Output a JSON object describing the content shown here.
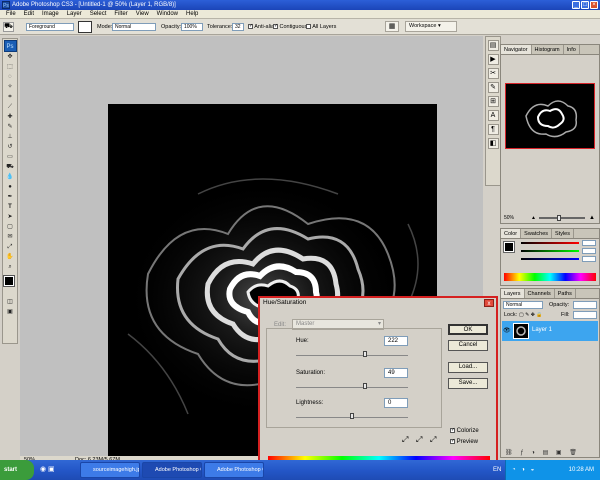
{
  "window": {
    "title": "Adobe Photoshop CS3 - [Untitled-1 @ 50% (Layer 1, RGB/8)]",
    "app_icon": "Ps"
  },
  "menu": [
    "File",
    "Edit",
    "Image",
    "Layer",
    "Select",
    "Filter",
    "View",
    "Window",
    "Help"
  ],
  "options_bar": {
    "fill_select": "Foreground",
    "mode_label": "Mode:",
    "mode_value": "Normal",
    "opacity_label": "Opacity:",
    "opacity_value": "100%",
    "tolerance_label": "Tolerance:",
    "tolerance_value": "32",
    "anti_alias_label": "Anti-alias",
    "contiguous_label": "Contiguous",
    "all_layers_label": "All Layers",
    "workspace_label": "Workspace"
  },
  "tools_panel": {
    "logo": "Ps"
  },
  "navigator_panel": {
    "tabs": [
      "Navigator",
      "Histogram",
      "Info"
    ],
    "zoom": "50%"
  },
  "color_panel": {
    "tabs": [
      "Color",
      "Swatches",
      "Styles"
    ]
  },
  "layers_panel": {
    "tabs": [
      "Layers",
      "Channels",
      "Paths"
    ],
    "blend_mode": "Normal",
    "opacity_label": "Opacity:",
    "lock_label": "Lock:",
    "fill_label": "Fill:",
    "layer_name": "Layer 1"
  },
  "status_bar": {
    "zoom": "50%",
    "doc_info": "Doc: 6.23M/5.67M"
  },
  "dialog": {
    "title": "Hue/Saturation",
    "close": "x",
    "edit_label": "Edit:",
    "edit_value": "Master",
    "hue_label": "Hue:",
    "hue_value": "222",
    "hue_fraction": 0.62,
    "saturation_label": "Saturation:",
    "saturation_value": "49",
    "saturation_fraction": 0.62,
    "lightness_label": "Lightness:",
    "lightness_value": "0",
    "lightness_fraction": 0.5,
    "ok": "OK",
    "cancel": "Cancel",
    "load": "Load...",
    "save": "Save...",
    "colorize_label": "Colorize",
    "colorize_checked": true,
    "preview_label": "Preview",
    "preview_checked": true
  },
  "taskbar": {
    "start": "start",
    "tasks": [
      "sourceimagehigh.jp...",
      "Adobe Photoshop C...",
      "Adobe Photoshop C..."
    ],
    "lang": "EN",
    "time": "10:28 AM"
  }
}
